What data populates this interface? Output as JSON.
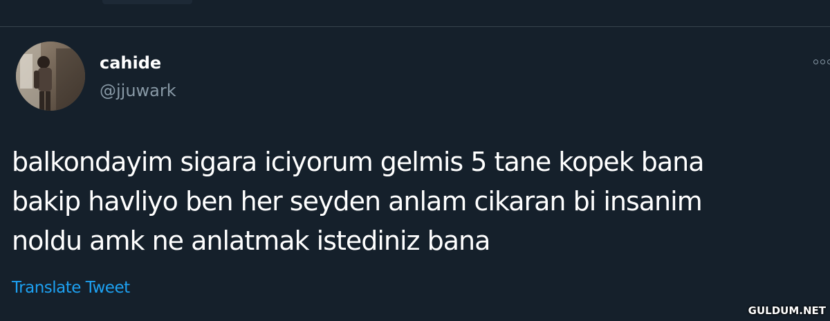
{
  "theme": {
    "background": "#15202b",
    "divider": "#38444d",
    "text_primary": "#ffffff",
    "text_secondary": "#8899a6",
    "link": "#1da1f2"
  },
  "tweet": {
    "author": {
      "display_name": "cahide",
      "handle": "@jjuwark",
      "avatar_icon": "profile-photo"
    },
    "more_icon": "more-options-icon",
    "text_lines": [
      "balkondayim sigara iciyorum gelmis 5 tane kopek bana",
      "bakip havliyo ben her seyden anlam cikaran bi insanim",
      "noldu amk ne anlatmak istediniz bana"
    ],
    "translate_label": "Translate Tweet"
  },
  "watermark": {
    "text": "GULDUM.NET"
  }
}
